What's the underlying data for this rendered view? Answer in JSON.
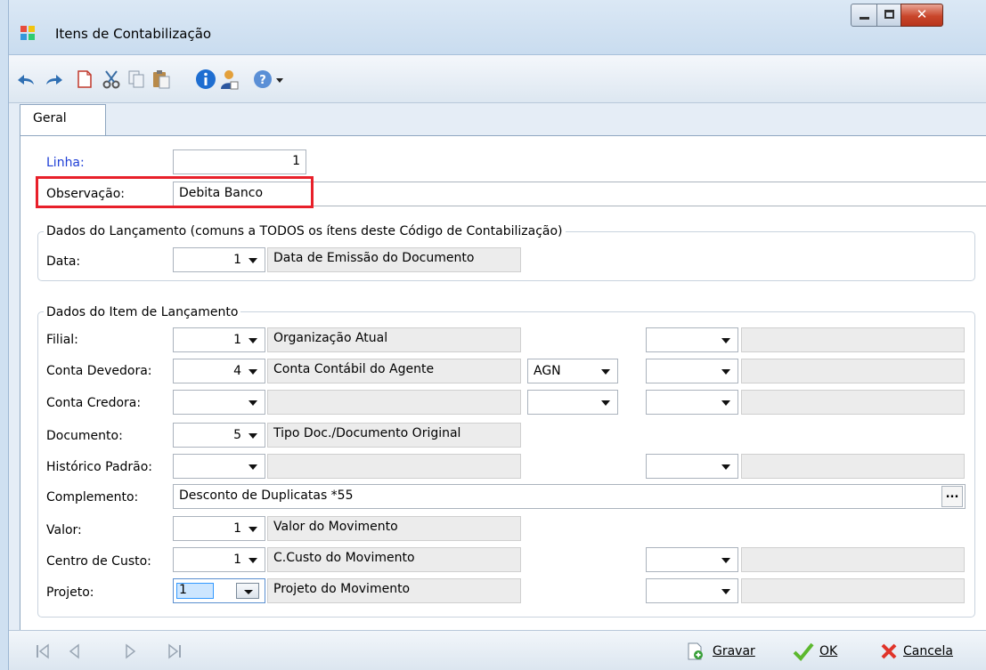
{
  "window": {
    "title": "Itens de Contabilização"
  },
  "tabs": [
    {
      "label": "Geral"
    }
  ],
  "header": {
    "linha_label": "Linha:",
    "linha_value": "1",
    "observacao_label": "Observação:",
    "observacao_value": "Debita Banco"
  },
  "lancamento": {
    "legend": "Dados do Lançamento (comuns a TODOS os ítens deste Código de Contabilização)",
    "data_label": "Data:",
    "data_value": "1",
    "data_desc": "Data de Emissão do Documento"
  },
  "item": {
    "legend": "Dados do Item de Lançamento",
    "filial": {
      "label": "Filial:",
      "value": "1",
      "desc": "Organização Atual"
    },
    "conta_devedora": {
      "label": "Conta Devedora:",
      "value": "4",
      "desc": "Conta Contábil do Agente",
      "extra": "AGN"
    },
    "conta_credora": {
      "label": "Conta Credora:"
    },
    "documento": {
      "label": "Documento:",
      "value": "5",
      "desc": "Tipo Doc./Documento Original"
    },
    "historico": {
      "label": "Histórico Padrão:"
    },
    "complemento": {
      "label": "Complemento:",
      "value": "Desconto de Duplicatas *55",
      "button": "..."
    },
    "valor": {
      "label": "Valor:",
      "value": "1",
      "desc": "Valor do Movimento"
    },
    "centro_custo": {
      "label": "Centro de Custo:",
      "value": "1",
      "desc": "C.Custo do Movimento"
    },
    "projeto": {
      "label": "Projeto:",
      "value": "1",
      "desc": "Projeto do Movimento"
    }
  },
  "actions": {
    "save": "Gravar",
    "ok": "OK",
    "cancel": "Cancela"
  },
  "colors": {
    "highlight": "#e8202a",
    "link_blue": "#1f3fd6",
    "selection": "#3399ff"
  }
}
